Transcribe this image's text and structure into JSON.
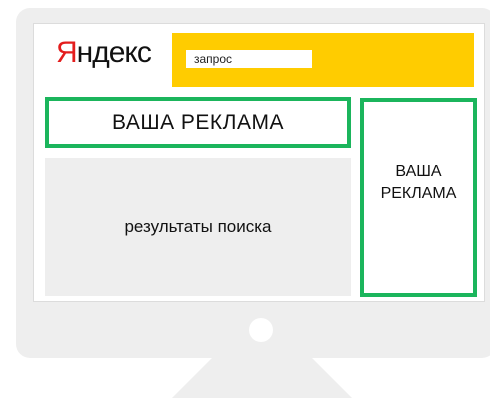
{
  "logo": {
    "first_letter": "Я",
    "rest": "ндекс"
  },
  "search": {
    "value": "запрос"
  },
  "ad_top": {
    "label": "ВАША РЕКЛАМА"
  },
  "results": {
    "label": "результаты поиска"
  },
  "ad_side": {
    "line1": "ВАША",
    "line2": "РЕКЛАМА"
  },
  "colors": {
    "accent_green": "#1bb55c",
    "search_yellow": "#ffcc00",
    "logo_red": "#e31d1d",
    "monitor_gray": "#eeeeee"
  }
}
